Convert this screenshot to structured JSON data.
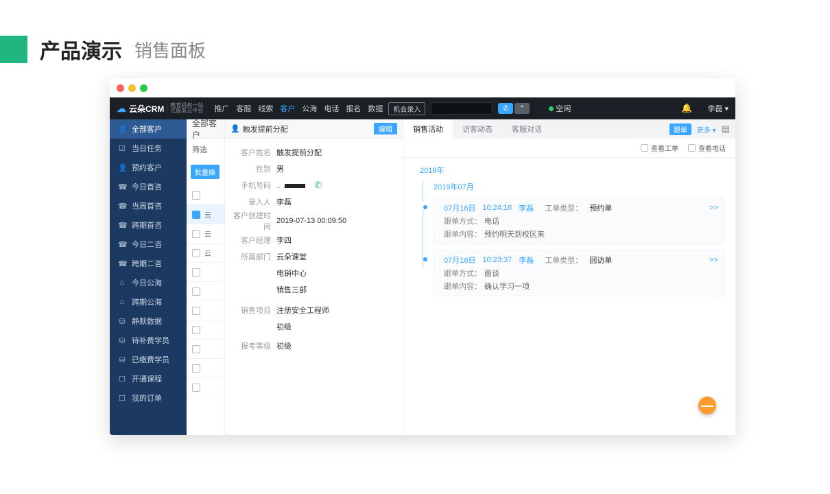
{
  "page": {
    "title": "产品演示",
    "subtitle": "销售面板"
  },
  "topbar": {
    "brand": "云朵CRM",
    "brand_sub_line1": "教育机构一站",
    "brand_sub_line2": "式服务云平台",
    "nav": [
      "推广",
      "客服",
      "线索",
      "客户",
      "公海",
      "电话",
      "报名",
      "数据"
    ],
    "nav_active_index": 3,
    "opportunity_btn": "机会录入",
    "status_text": "空闲",
    "user_name": "李磊"
  },
  "sidebar": {
    "items": [
      {
        "icon": "👤",
        "label": "全部客户",
        "active": true
      },
      {
        "icon": "☑",
        "label": "当日任务"
      },
      {
        "icon": "👤",
        "label": "预约客户"
      },
      {
        "icon": "☎",
        "label": "今日首咨"
      },
      {
        "icon": "☎",
        "label": "当周首咨"
      },
      {
        "icon": "☎",
        "label": "跨期首咨"
      },
      {
        "icon": "☎",
        "label": "今日二咨"
      },
      {
        "icon": "☎",
        "label": "跨期二咨"
      },
      {
        "icon": "⌂",
        "label": "今日公海"
      },
      {
        "icon": "⌂",
        "label": "跨期公海"
      },
      {
        "icon": "⛁",
        "label": "静默数据"
      },
      {
        "icon": "⛁",
        "label": "待补费学员"
      },
      {
        "icon": "⛁",
        "label": "已缴费学员"
      },
      {
        "icon": "☐",
        "label": "开通课程"
      },
      {
        "icon": "☐",
        "label": "我的订单"
      }
    ]
  },
  "list": {
    "title": "全部客户",
    "filter_label": "筛选",
    "batch_btn": "批量操",
    "rows": [
      {
        "text": "",
        "selected": false
      },
      {
        "text": "云",
        "selected": true
      },
      {
        "text": "云",
        "selected": false
      },
      {
        "text": "云",
        "selected": false
      },
      {
        "text": "",
        "selected": false
      },
      {
        "text": "",
        "selected": false
      },
      {
        "text": "",
        "selected": false
      },
      {
        "text": "",
        "selected": false
      },
      {
        "text": "",
        "selected": false
      },
      {
        "text": "",
        "selected": false
      },
      {
        "text": "",
        "selected": false
      }
    ]
  },
  "detail": {
    "header_title": "触发提前分配",
    "edit_btn": "编辑",
    "fields": {
      "name_label": "客户姓名",
      "name": "触发提前分配",
      "gender_label": "性别",
      "gender": "男",
      "phone_label": "手机号码",
      "entry_label": "录入人",
      "entry": "李磊",
      "created_label": "客户创建时间",
      "created": "2019-07-13 00:09:50",
      "manager_label": "客户经理",
      "manager": "李四",
      "dept_label": "所属部门",
      "dept": "云朵课堂",
      "dept2": "电销中心",
      "dept3": "销售三部",
      "project_label": "销售项目",
      "project": "注册安全工程师",
      "project2": "初级",
      "exam_label": "报考等级",
      "exam": "初级"
    }
  },
  "activity": {
    "tabs": [
      "销售活动",
      "访客动态",
      "客服对话"
    ],
    "active_tab": 0,
    "follow_btn": "跟单",
    "more": "更多 ▾",
    "filter_ticket": "查看工单",
    "filter_call": "查看电话",
    "year": "2019年",
    "month": "2019年07月",
    "items": [
      {
        "date": "07月16日",
        "time": "10:24:16",
        "user": "李磊",
        "type_label": "工单类型：",
        "type": "预约单",
        "method_label": "跟单方式：",
        "method": "电话",
        "content_label": "跟单内容：",
        "content": "预约明天到校区来",
        "more": ">>"
      },
      {
        "date": "07月16日",
        "time": "10:23:37",
        "user": "李磊",
        "type_label": "工单类型：",
        "type": "回访单",
        "method_label": "跟单方式：",
        "method": "面谈",
        "content_label": "跟单内容：",
        "content": "确认学习一项",
        "more": ">>"
      }
    ]
  },
  "fab": "—"
}
